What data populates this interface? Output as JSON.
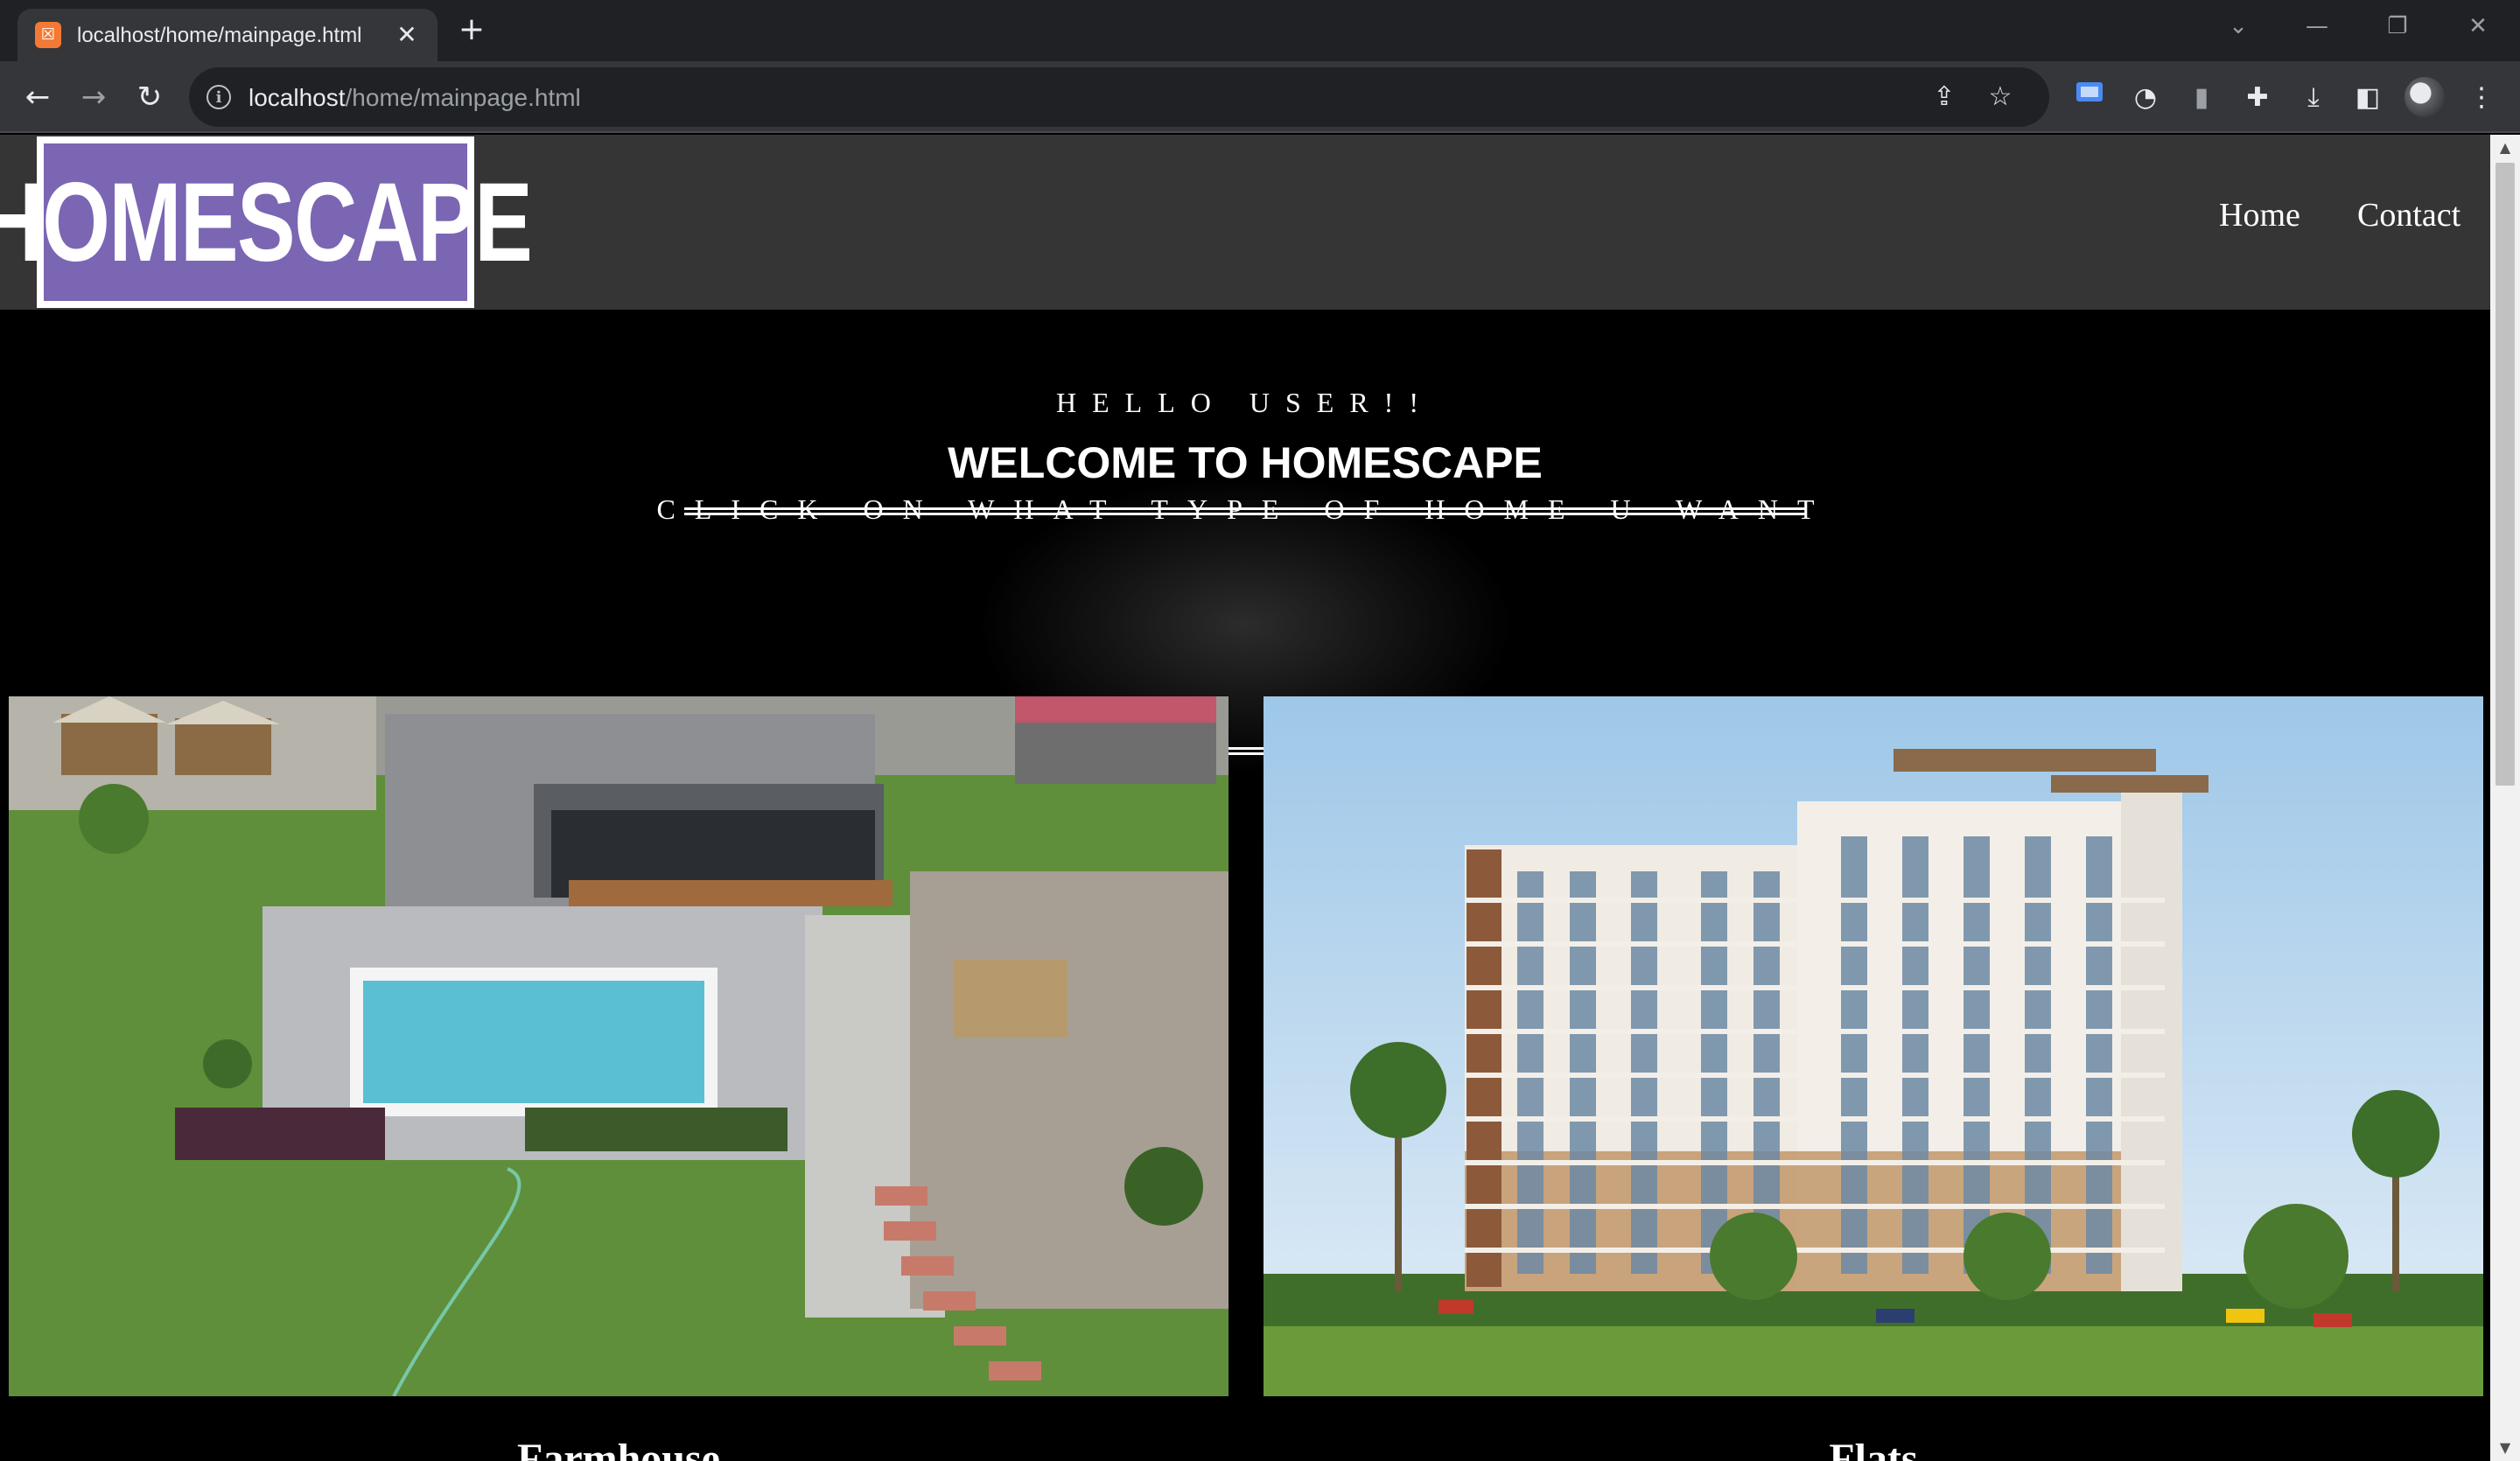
{
  "browser": {
    "tab_title": "localhost/home/mainpage.html",
    "tab_favicon": "xampp-icon",
    "close_glyph": "✕",
    "new_tab_glyph": "+",
    "url_host": "localhost",
    "url_path": "/home/mainpage.html",
    "window_controls": [
      "⌄",
      "—",
      "❐",
      "✕"
    ]
  },
  "site": {
    "logo_text": "HOMESCAPE",
    "logo_color": "#7a66b3",
    "nav": [
      {
        "label": "Home"
      },
      {
        "label": "Contact"
      }
    ]
  },
  "hero": {
    "greeting": "HELLO USER!!",
    "title": "WELCOME TO HOMESCAPE",
    "subtitle": "CLICK ON WHAT TYPE OF HOME U WANT"
  },
  "cards": [
    {
      "caption": "Farmhouse",
      "image": "farmhouse-with-pool-photo"
    },
    {
      "caption": "Flats",
      "image": "apartment-tower-photo"
    }
  ]
}
